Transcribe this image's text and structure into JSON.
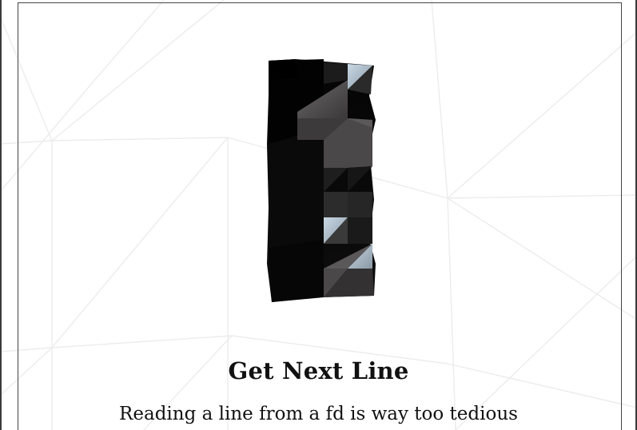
{
  "document": {
    "title": "Get Next Line",
    "subtitle": "Reading a line from a fd is way too tedious",
    "logo_icon": "42-emblem-icon"
  },
  "colors": {
    "background": "#ffffff",
    "frame": "#444444",
    "pattern_lines": "#eeeeee",
    "text": "#111111"
  }
}
